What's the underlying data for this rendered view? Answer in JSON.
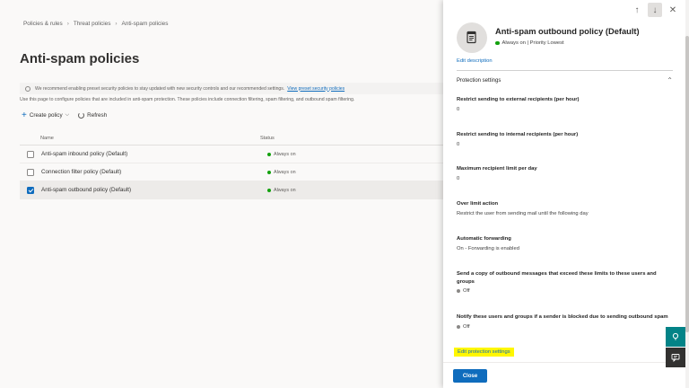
{
  "breadcrumb": [
    "Policies & rules",
    "Threat policies",
    "Anti-spam policies"
  ],
  "page_title": "Anti-spam policies",
  "banner": {
    "text": "We recommend enabling preset security policies to stay updated with new security controls and our recommended settings.",
    "link": "View preset security policies"
  },
  "description": "Use this page to configure policies that are included in anti-spam protection. These policies include connection filtering, spam filtering, and outbound spam filtering.",
  "toolbar": {
    "create_label": "Create policy",
    "refresh_label": "Refresh"
  },
  "table": {
    "columns": [
      "Name",
      "Status"
    ],
    "rows": [
      {
        "name": "Anti-spam inbound policy (Default)",
        "status": "Always on",
        "selected": false
      },
      {
        "name": "Connection filter policy (Default)",
        "status": "Always on",
        "selected": false
      },
      {
        "name": "Anti-spam outbound policy (Default)",
        "status": "Always on",
        "selected": true
      }
    ]
  },
  "panel": {
    "title": "Anti-spam outbound policy (Default)",
    "subtitle": "Always on | Priority Lowest",
    "edit_description": "Edit description",
    "section_title": "Protection settings",
    "settings": [
      {
        "label": "Restrict sending to external recipients (per hour)",
        "value": "0"
      },
      {
        "label": "Restrict sending to internal recipients (per hour)",
        "value": "0"
      },
      {
        "label": "Maximum recipient limit per day",
        "value": "0"
      },
      {
        "label": "Over limit action",
        "value": "Restrict the user from sending mail until the following day"
      },
      {
        "label": "Automatic forwarding",
        "value": "On - Forwarding is enabled"
      },
      {
        "label": "Send a copy of outbound messages that exceed these limits to these users and groups",
        "value": "Off"
      },
      {
        "label": "Notify these users and groups if a sender is blocked due to sending outbound spam",
        "value": "Off"
      }
    ],
    "edit_protection": "Edit protection settings",
    "close_label": "Close"
  },
  "colors": {
    "accent": "#0f6cbd",
    "status_green": "#13a10e",
    "highlight": "#fff700"
  },
  "icons": {
    "breadcrumb_separator": "chevron-right-icon",
    "banner": "lightbulb-icon",
    "policy": "policy-document-icon",
    "help": "help-bulb-icon",
    "chat": "chat-icon"
  }
}
